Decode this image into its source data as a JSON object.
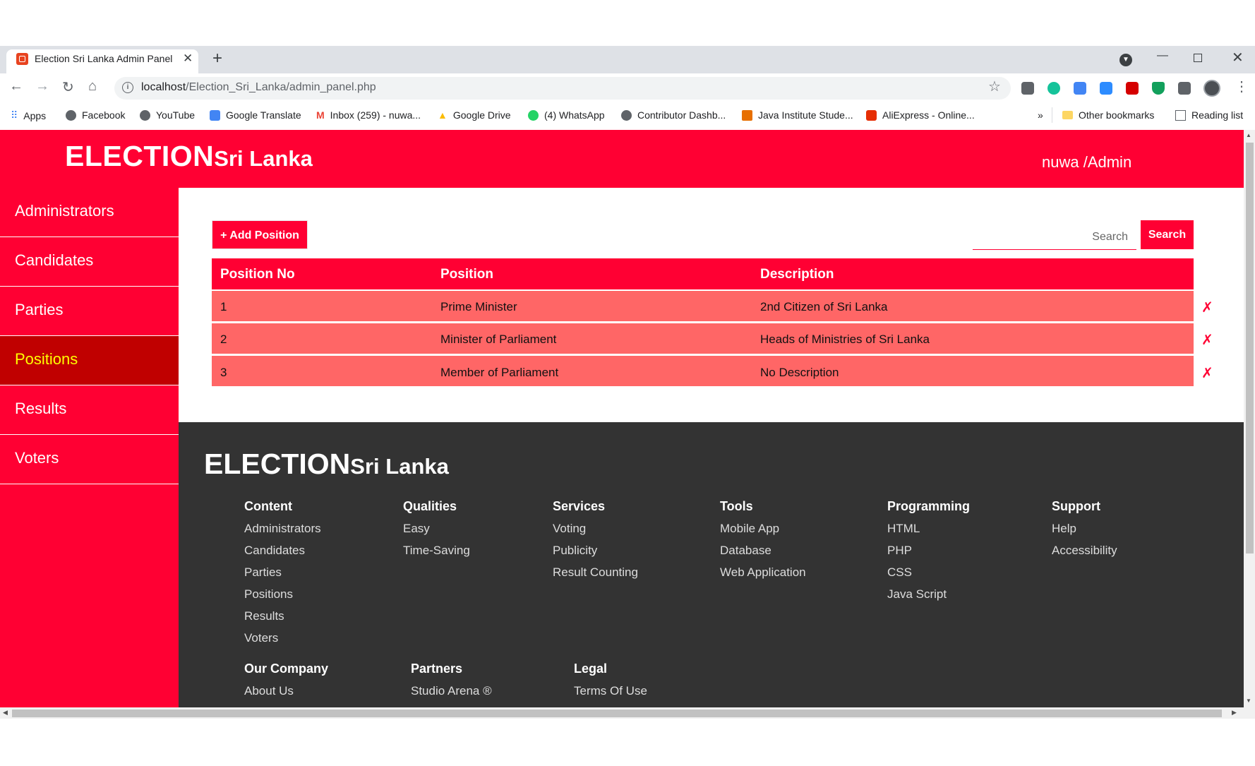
{
  "browser": {
    "tab_title": "Election Sri Lanka Admin Panel",
    "url_host": "localhost",
    "url_path": "/Election_Sri_Lanka/admin_panel.php",
    "bookmarks": [
      {
        "label": "Apps",
        "icon": "apps-grid-icon"
      },
      {
        "label": "Facebook",
        "icon": "globe-icon"
      },
      {
        "label": "YouTube",
        "icon": "globe-icon"
      },
      {
        "label": "Google Translate",
        "icon": "translate-icon"
      },
      {
        "label": "Inbox (259) - nuwa...",
        "icon": "gmail-icon"
      },
      {
        "label": "Google Drive",
        "icon": "drive-icon"
      },
      {
        "label": "(4) WhatsApp",
        "icon": "whatsapp-icon"
      },
      {
        "label": "Contributor Dashb...",
        "icon": "globe-icon"
      },
      {
        "label": "Java Institute Stude...",
        "icon": "java-icon"
      },
      {
        "label": "AliExpress - Online...",
        "icon": "aliexpress-icon"
      }
    ],
    "overflow": "»",
    "other_bookmarks": "Other bookmarks",
    "reading_list": "Reading list"
  },
  "header": {
    "logo_big": "ELECTION",
    "logo_small": "Sri Lanka",
    "user": "nuwa /Admin"
  },
  "sidebar": {
    "items": [
      "Administrators",
      "Candidates",
      "Parties",
      "Positions",
      "Results",
      "Voters"
    ],
    "active": "Positions"
  },
  "main": {
    "add_button": "+ Add Position",
    "search_placeholder": "Search",
    "search_button": "Search",
    "columns": [
      "Position No",
      "Position",
      "Description"
    ],
    "rows": [
      [
        "1",
        "Prime Minister",
        "2nd Citizen of Sri Lanka"
      ],
      [
        "2",
        "Minister of Parliament",
        "Heads of Ministries of Sri Lanka"
      ],
      [
        "3",
        "Member of Parliament",
        "No Description"
      ]
    ],
    "delete_glyph": "✗"
  },
  "footer": {
    "logo_big": "ELECTION",
    "logo_small": "Sri Lanka",
    "columns": [
      {
        "title": "Content",
        "links": [
          "Administrators",
          "Candidates",
          "Parties",
          "Positions",
          "Results",
          "Voters"
        ]
      },
      {
        "title": "Qualities",
        "links": [
          "Easy",
          "Time-Saving"
        ]
      },
      {
        "title": "Services",
        "links": [
          "Voting",
          "Publicity",
          "Result Counting"
        ]
      },
      {
        "title": "Tools",
        "links": [
          "Mobile App",
          "Database",
          "Web Application"
        ]
      },
      {
        "title": "Programming",
        "links": [
          "HTML",
          "PHP",
          "CSS",
          "Java Script"
        ]
      },
      {
        "title": "Support",
        "links": [
          "Help",
          "Accessibility"
        ]
      }
    ],
    "columns2": [
      {
        "title": "Our Company",
        "links": [
          "About Us"
        ]
      },
      {
        "title": "Partners",
        "links": [
          "Studio Arena ®"
        ]
      },
      {
        "title": "Legal",
        "links": [
          "Terms Of Use"
        ]
      }
    ]
  },
  "colors": {
    "brand_red": "#ff0033",
    "row_red": "#ff6666",
    "active_sidebar": "#c00000",
    "active_text": "#ffff00",
    "footer_bg": "#333333"
  }
}
